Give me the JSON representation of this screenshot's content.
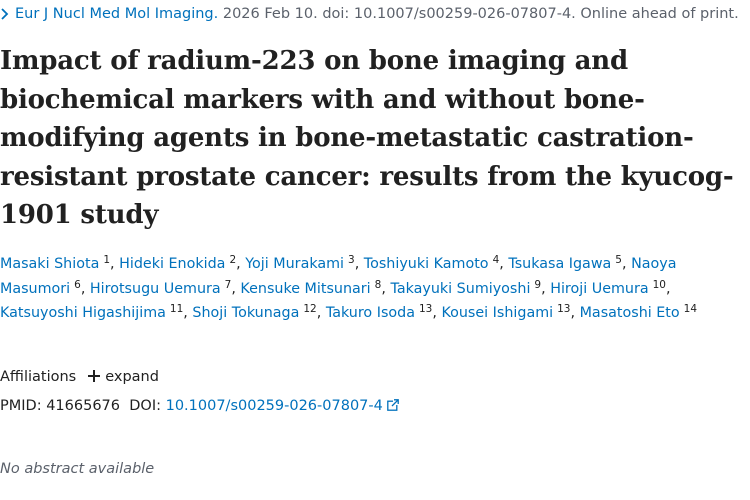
{
  "citation": {
    "journal": "Eur J Nucl Med Mol Imaging.",
    "details": "2026 Feb 10. doi: 10.1007/s00259-026-07807-4. Online ahead of print."
  },
  "title": "Impact of radium-223 on bone imaging and biochemical markers with and without bone-modifying agents in bone-metastatic castration-resistant prostate cancer: results from the kyucog-1901 study",
  "authors": [
    {
      "name": "Masaki Shiota",
      "aff": "1"
    },
    {
      "name": "Hideki Enokida",
      "aff": "2"
    },
    {
      "name": "Yoji Murakami",
      "aff": "3"
    },
    {
      "name": "Toshiyuki Kamoto",
      "aff": "4"
    },
    {
      "name": "Tsukasa Igawa",
      "aff": "5"
    },
    {
      "name": "Naoya Masumori",
      "aff": "6"
    },
    {
      "name": "Hirotsugu Uemura",
      "aff": "7"
    },
    {
      "name": "Kensuke Mitsunari",
      "aff": "8"
    },
    {
      "name": "Takayuki Sumiyoshi",
      "aff": "9"
    },
    {
      "name": "Hiroji Uemura",
      "aff": "10"
    },
    {
      "name": "Katsuyoshi Higashijima",
      "aff": "11"
    },
    {
      "name": "Shoji Tokunaga",
      "aff": "12"
    },
    {
      "name": "Takuro Isoda",
      "aff": "13"
    },
    {
      "name": "Kousei Ishigami",
      "aff": "13"
    },
    {
      "name": "Masatoshi Eto",
      "aff": "14"
    }
  ],
  "affiliations": {
    "label": "Affiliations",
    "toggle": "expand"
  },
  "ids": {
    "pmid_label": "PMID:",
    "pmid": "41665676",
    "doi_label": "DOI:",
    "doi": "10.1007/s00259-026-07807-4"
  },
  "abstract_note": "No abstract available",
  "icons": {
    "citation_chevron": "chevron-right-icon",
    "expand": "plus-icon",
    "doi_link": "external-link-icon"
  },
  "colors": {
    "link": "#0071bc",
    "text": "#212121",
    "muted": "#5b616b"
  }
}
